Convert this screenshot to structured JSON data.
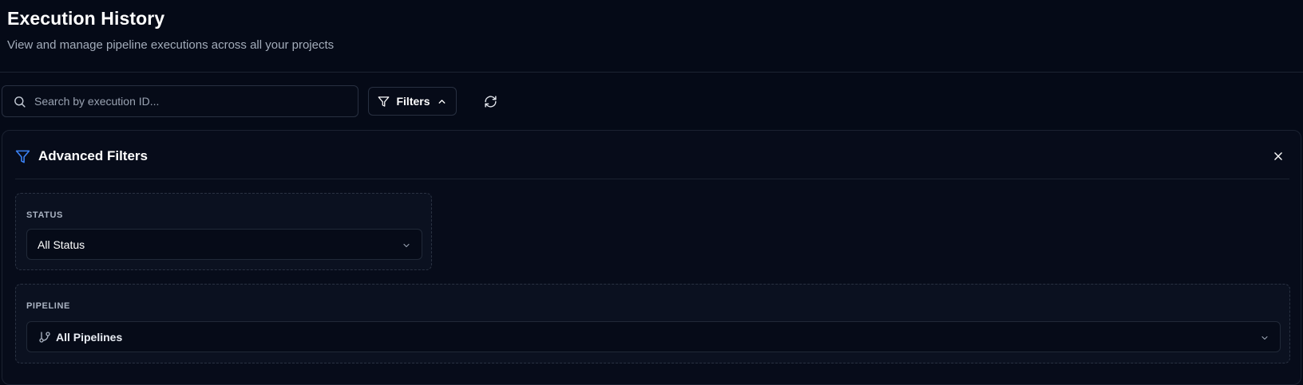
{
  "header": {
    "title": "Execution History",
    "subtitle": "View and manage pipeline executions across all your projects"
  },
  "toolbar": {
    "search_placeholder": "Search by execution ID...",
    "search_value": "",
    "filters_label": "Filters",
    "filters_expanded": true
  },
  "advanced_filters": {
    "title": "Advanced Filters",
    "status": {
      "label": "STATUS",
      "selected": "All Status"
    },
    "pipeline": {
      "label": "PIPELINE",
      "selected": "All Pipelines"
    }
  },
  "colors": {
    "background": "#050a17",
    "panel": "#070c1a",
    "card": "#0b1120",
    "accent_filter_icon": "#3b82f6",
    "border": "#283041"
  },
  "icons": {
    "search": "search-icon",
    "filter": "filter-icon",
    "chevron_up": "chevron-up-icon",
    "refresh": "refresh-icon",
    "close": "close-icon",
    "chevron_down": "chevron-down-icon",
    "branch": "git-branch-icon"
  }
}
